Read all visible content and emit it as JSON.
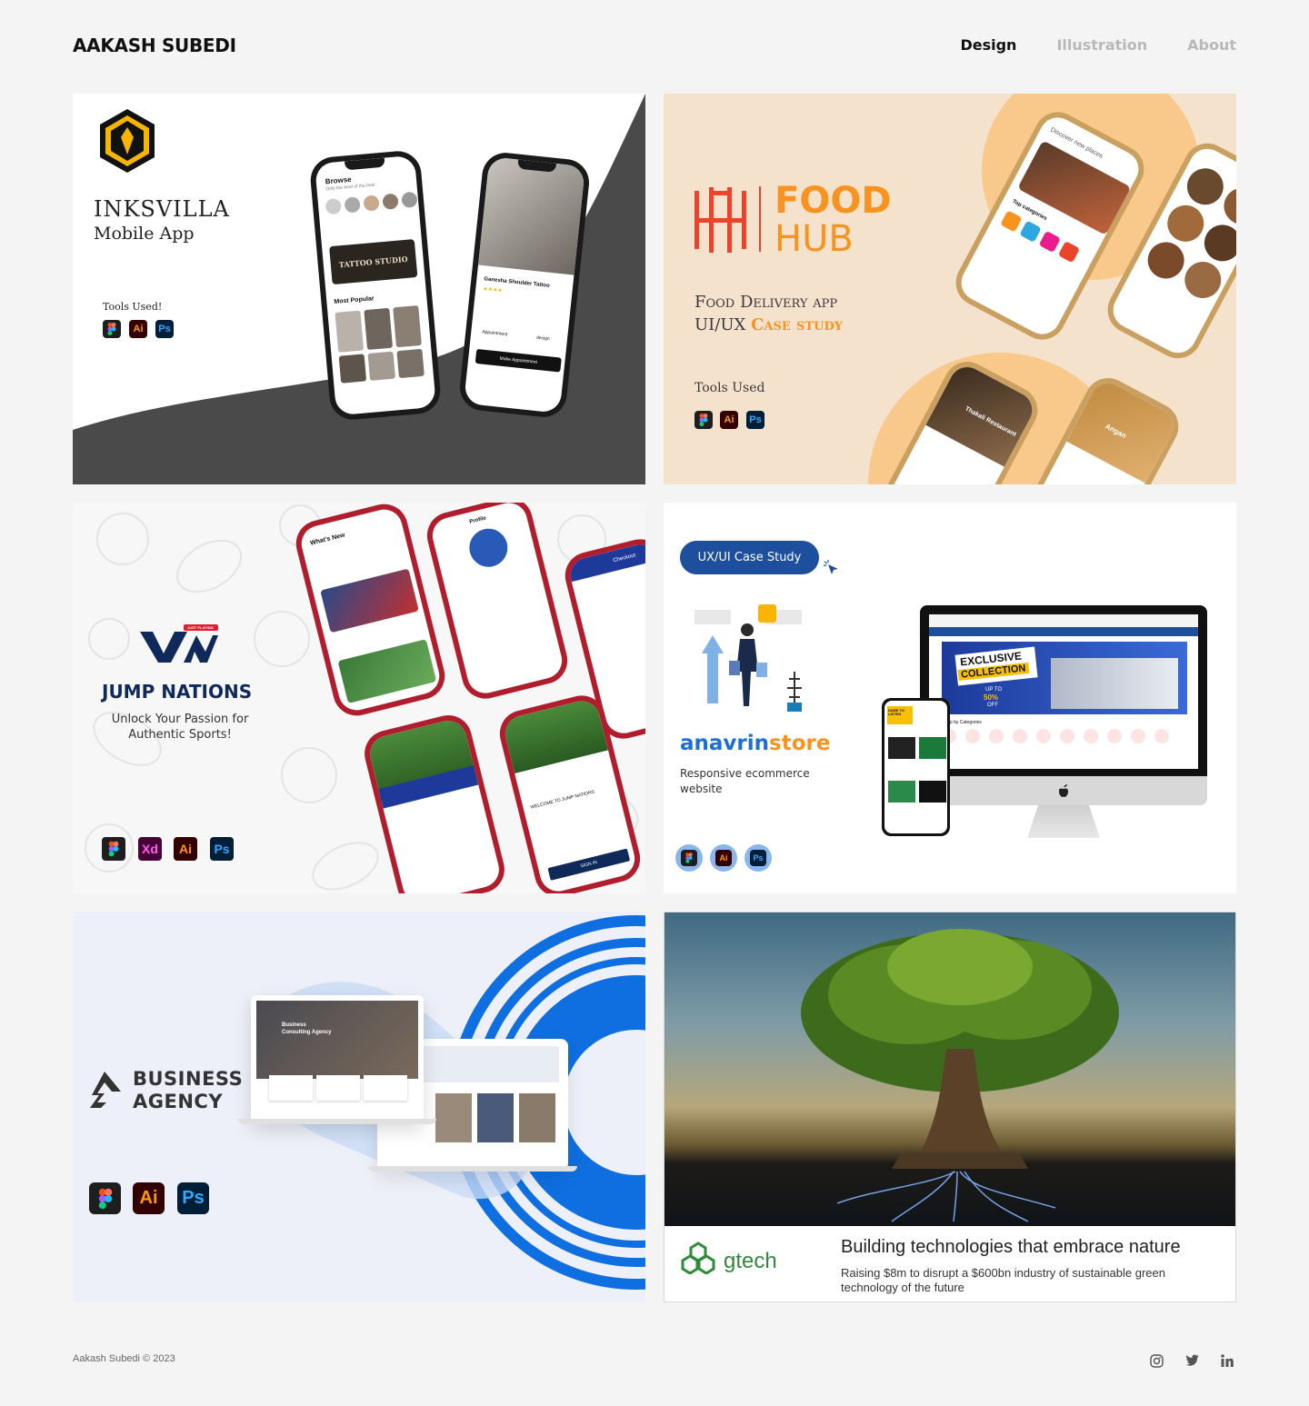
{
  "header": {
    "brand": "AAKASH SUBEDI",
    "nav": [
      {
        "label": "Design",
        "active": true
      },
      {
        "label": "Illustration",
        "active": false
      },
      {
        "label": "About",
        "active": false
      }
    ]
  },
  "projects": {
    "inksvilla": {
      "title": "INKSVILLA",
      "subtitle": "Mobile App",
      "tools_label": "Tools Used!",
      "tools": [
        "figma-icon",
        "Ai",
        "Ps"
      ],
      "screen1_header": "Browse",
      "screen1_sub": "Only the best of the best",
      "screen1_banner": "TATTOO STUDIO",
      "screen1_section": "Most Popular",
      "screen2_title": "Ganesha Shoulder Tattoo",
      "screen2_btn": "Make Appointment",
      "screen2_left": "Appointment",
      "screen2_right": "design"
    },
    "foodhub": {
      "logo_top": "FOOD",
      "logo_bottom": "HUB",
      "line1": "Food Delivery app",
      "line2_a": "UI/UX ",
      "line2_b": "Case study",
      "tools_label": "Tools Used",
      "tools": [
        "figma-icon",
        "Ai",
        "Ps"
      ],
      "phone1_title": "Discover new places",
      "phone1_sub": "Top categories",
      "phone3_title": "Thakali Restaurant",
      "phone4_title": "Angan"
    },
    "jumpnations": {
      "badge": "JUST PLAYING",
      "title": "JUMP NATIONS",
      "tagline_1": "Unlock Your Passion for",
      "tagline_2": "Authentic Sports!",
      "tools": [
        "figma-icon",
        "Xd",
        "Ai",
        "Ps"
      ],
      "phone1_header": "What's New",
      "phone2_header": "Profile",
      "phone3_header": "Checkout",
      "phone5_text": "WELCOME TO JUMP NATIONS",
      "phone5_btn": "SIGN IN"
    },
    "anavrin": {
      "pill": "UX/UI Case Study",
      "brand_a": "anavrin",
      "brand_b": "store",
      "desc_1": "Responsive ecommerce",
      "desc_2": "website",
      "tools": [
        "figma-icon",
        "Ai",
        "Ps"
      ],
      "banner_1": "EXCLUSIVE",
      "banner_2": "COLLECTION",
      "banner_3": "UP TO",
      "banner_4": "50%",
      "banner_5": "OFF",
      "mobile_banner": "DARE TO LISTEN",
      "categories_label": "Shop by Categories"
    },
    "business": {
      "title_1": "BUSINESS",
      "title_2": "AGENCY",
      "tools": [
        "figma-icon",
        "Ai",
        "Ps"
      ],
      "screen_title_1": "Business",
      "screen_title_2": "Consulting Agency"
    },
    "gtech": {
      "brand": "gtech",
      "headline": "Building technologies that embrace nature",
      "desc_1": "Raising $8m to disrupt a $600bn industry of sustainable green",
      "desc_2": "technology of the future"
    }
  },
  "footer": {
    "copyright": "Aakash Subedi © 2023",
    "social": [
      "instagram-icon",
      "twitter-icon",
      "linkedin-icon"
    ]
  },
  "colors": {
    "accent_orange": "#f7931e",
    "food_red": "#e8452c",
    "jump_navy": "#0f2a5a",
    "anavrin_blue": "#1d4f9e",
    "gtech_green": "#2e8b3a",
    "business_blue": "#0f6fe0"
  }
}
